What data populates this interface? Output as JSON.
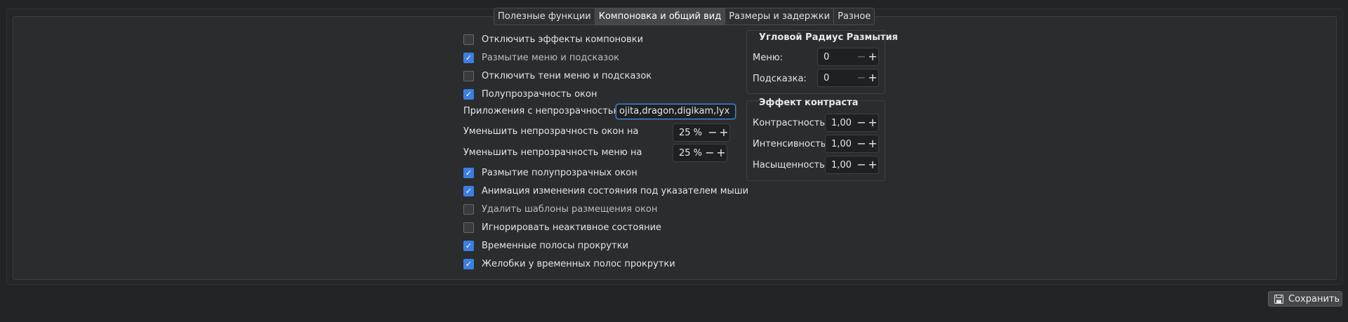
{
  "tabs": [
    {
      "label": "Полезные функции",
      "active": false
    },
    {
      "label": "Компоновка и общий вид",
      "active": true
    },
    {
      "label": "Размеры и задержки",
      "active": false
    },
    {
      "label": "Разное",
      "active": false
    }
  ],
  "options": [
    {
      "label": "Отключить эффекты компоновки",
      "checked": false,
      "enabled": true
    },
    {
      "label": "Размытие меню и подсказок",
      "checked": true,
      "enabled": false
    },
    {
      "label": "Отключить тени меню и подсказок",
      "checked": false,
      "enabled": true
    },
    {
      "label": "Полупрозрачность окон",
      "checked": true,
      "enabled": true
    },
    {
      "label": "Размытие полупрозрачных окон",
      "checked": true,
      "enabled": true
    },
    {
      "label": "Анимация изменения состояния под указателем мыши",
      "checked": true,
      "enabled": true
    },
    {
      "label": "Удалить шаблоны размещения окон",
      "checked": false,
      "enabled": false
    },
    {
      "label": "Игнорировать неактивное состояние",
      "checked": false,
      "enabled": true
    },
    {
      "label": "Временные полосы прокрутки",
      "checked": true,
      "enabled": true
    },
    {
      "label": "Желобки у временных полос прокрутки",
      "checked": true,
      "enabled": true
    }
  ],
  "opaque_apps": {
    "label": "Приложения с непрозрачностью:",
    "value": "amarok,kdenlive,krita,dragon,digikam,lyx",
    "visible_text": "ojita,dragon,digikam,lyx"
  },
  "reduce_window_opacity": {
    "label": "Уменьшить непрозрачность окон на",
    "value": "25 %"
  },
  "reduce_menu_opacity": {
    "label": "Уменьшить непрозрачность меню на",
    "value": "25 %"
  },
  "blur_radius_group": {
    "title": "Угловой Радиус Размытия",
    "menu_label": "Меню:",
    "menu_value": "0",
    "tooltip_label": "Подсказка:",
    "tooltip_value": "0"
  },
  "contrast_group": {
    "title": "Эффект контраста",
    "contrast_label": "Контрастность:",
    "contrast_value": "1,00",
    "intensity_label": "Интенсивность:",
    "intensity_value": "1,00",
    "saturation_label": "Насыщенность:",
    "saturation_value": "1,00"
  },
  "save_button": {
    "label": "Сохранить",
    "icon": "save-icon"
  },
  "colors": {
    "accent": "#3d7fe0",
    "background": "#232425",
    "panel": "#2b2c2e"
  }
}
